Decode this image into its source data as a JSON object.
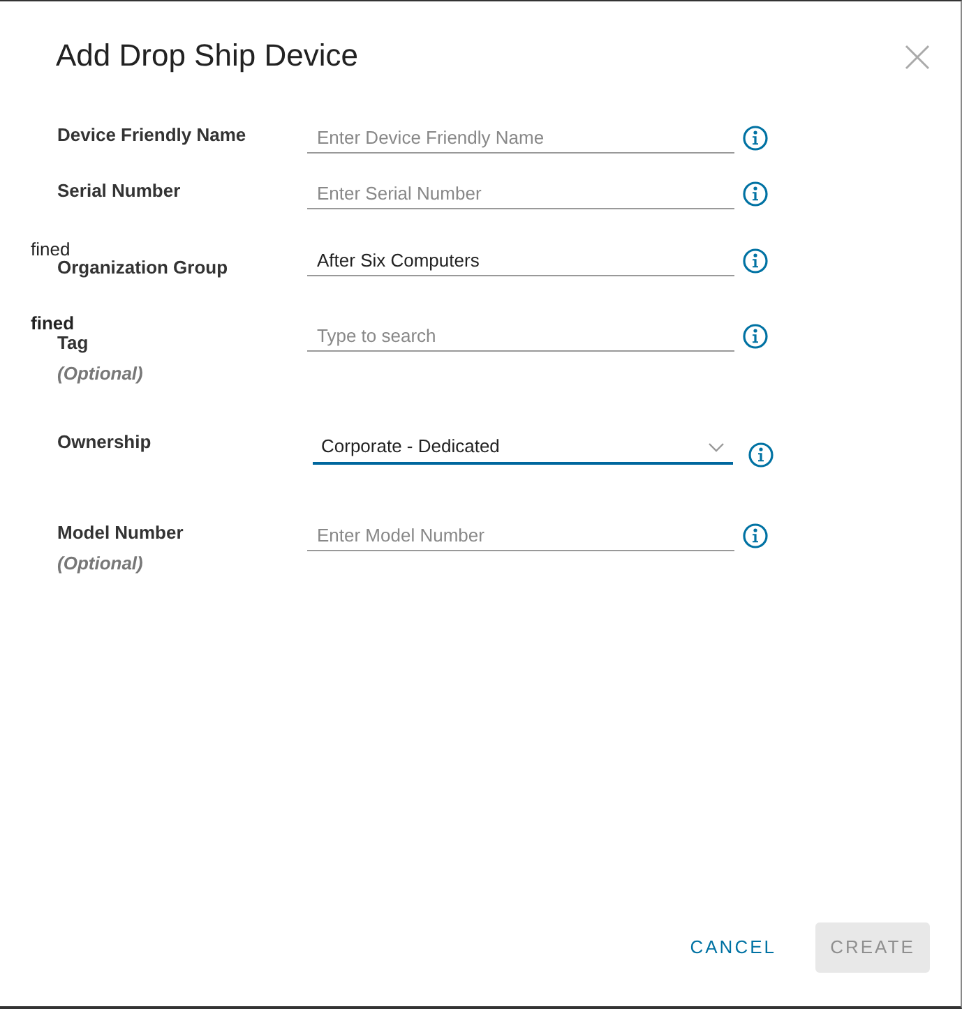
{
  "dialog": {
    "title": "Add Drop Ship Device"
  },
  "fields": [
    {
      "label": "Device Friendly Name",
      "kind": "text",
      "placeholder": "Enter Device Friendly Name"
    },
    {
      "label": "Serial Number",
      "kind": "text",
      "placeholder": "Enter Serial Number"
    },
    {
      "label": "Organization Group",
      "kind": "text",
      "value": "After Six Computers"
    },
    {
      "label": "Tag",
      "optional": "(Optional)",
      "kind": "text",
      "placeholder": "Type to search"
    },
    {
      "label": "Ownership",
      "kind": "select",
      "value": "Corporate - Dedicated",
      "focused": true
    },
    {
      "label": "Model Number",
      "optional": "(Optional)",
      "kind": "text",
      "placeholder": "Enter Model Number"
    }
  ],
  "stray_texts": [
    "fined",
    "fined"
  ],
  "buttons": [
    {
      "label": "CANCEL",
      "kind": "link",
      "disabled": false
    },
    {
      "label": "CREATE",
      "kind": "primary",
      "disabled": true
    }
  ]
}
